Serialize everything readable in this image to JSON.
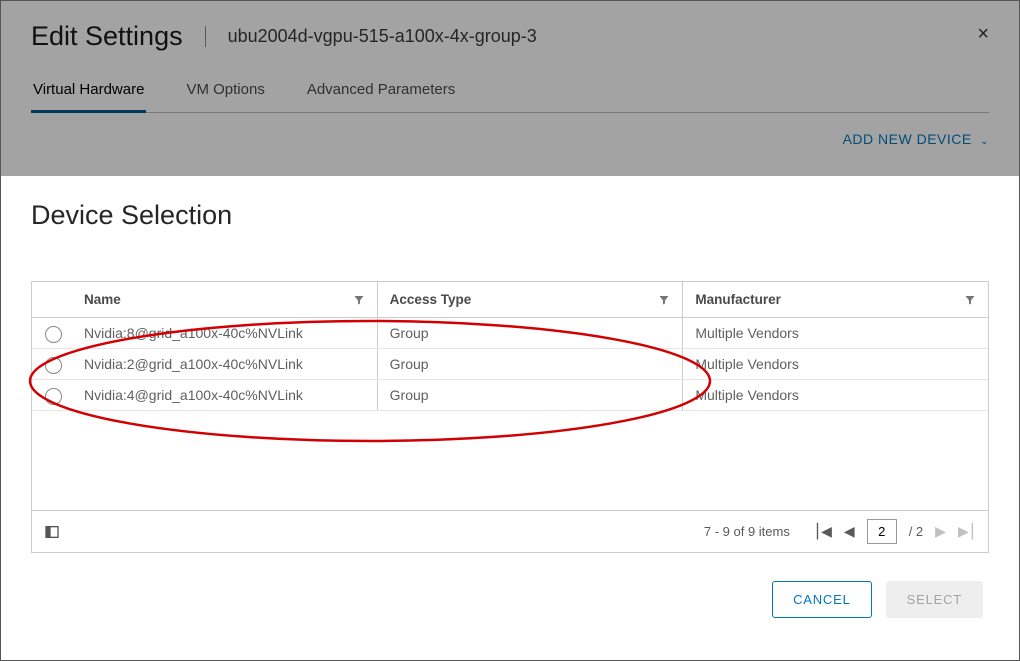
{
  "header": {
    "title": "Edit Settings",
    "subtitle": "ubu2004d-vgpu-515-a100x-4x-group-3",
    "close_icon": "×"
  },
  "tabs": [
    {
      "label": "Virtual Hardware",
      "active": true
    },
    {
      "label": "VM Options"
    },
    {
      "label": "Advanced Parameters"
    }
  ],
  "add_device": {
    "label": "ADD NEW DEVICE"
  },
  "modal": {
    "title": "Device Selection",
    "columns": {
      "name": "Name",
      "access": "Access Type",
      "manufacturer": "Manufacturer"
    },
    "rows": [
      {
        "name": "Nvidia:8@grid_a100x-40c%NVLink",
        "access": "Group",
        "manufacturer": "Multiple Vendors"
      },
      {
        "name": "Nvidia:2@grid_a100x-40c%NVLink",
        "access": "Group",
        "manufacturer": "Multiple Vendors"
      },
      {
        "name": "Nvidia:4@grid_a100x-40c%NVLink",
        "access": "Group",
        "manufacturer": "Multiple Vendors"
      }
    ],
    "pager": {
      "range": "7 - 9 of 9 items",
      "page": "2",
      "total": "/ 2"
    },
    "actions": {
      "cancel": "CANCEL",
      "select": "SELECT"
    }
  }
}
